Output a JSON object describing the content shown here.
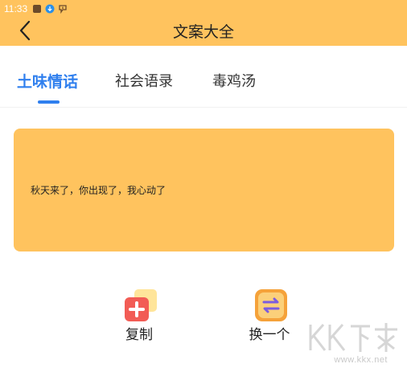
{
  "status_bar": {
    "time": "11:33",
    "icons": [
      "app-square-icon",
      "download-icon",
      "app-badge-icon"
    ]
  },
  "header": {
    "title": "文案大全",
    "back_icon": "chevron-left-icon",
    "background": "#ffc35e"
  },
  "tabs": [
    {
      "label": "土味情话",
      "active": true
    },
    {
      "label": "社会语录",
      "active": false
    },
    {
      "label": "毒鸡汤",
      "active": false
    }
  ],
  "accent_color": "#2f7fee",
  "quote": {
    "text": "秋天来了，你出现了，我心动了",
    "background": "#ffc35e"
  },
  "actions": {
    "copy": {
      "label": "复制",
      "icon": "plus-copy-icon"
    },
    "next": {
      "label": "换一个",
      "icon": "swap-arrows-icon"
    }
  },
  "watermark": {
    "logo": "KK下载",
    "url": "www.kkx.net"
  }
}
